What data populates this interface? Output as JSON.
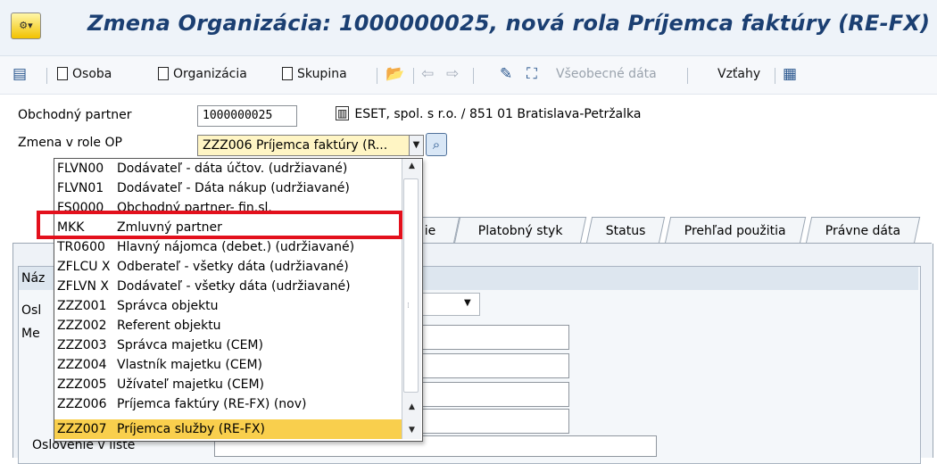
{
  "window": {
    "title": "Zmena Organizácia: 1000000025, nová rola Príjemca faktúry (RE-FX)"
  },
  "toolbar": {
    "person_label": "Osoba",
    "organization_label": "Organizácia",
    "group_label": "Skupina",
    "general_data_label": "Všeobecné dáta",
    "relations_label": "Vzťahy"
  },
  "header": {
    "partner_label": "Obchodný partner",
    "partner_value": "1000000025",
    "partner_description": "ESET, spol. s r.o. / 851 01 Bratislava-Petržalka",
    "role_label": "Zmena v role OP",
    "role_value": "ZZZ006 Príjemca faktúry (R..."
  },
  "tabs": [
    {
      "label": "ie"
    },
    {
      "label": "Platobný styk"
    },
    {
      "label": "Status"
    },
    {
      "label": "Prehľad použitia"
    },
    {
      "label": "Právne dáta"
    }
  ],
  "form": {
    "group_title_partial": "Náz",
    "field1_partial": "Osl",
    "field2_partial": "Me",
    "salutation_label": "Oslovenie v liste"
  },
  "dropdown": {
    "options": [
      {
        "code": "FLVN00",
        "desc": "Dodávateľ - dáta účtov. (udržiavané)"
      },
      {
        "code": "FLVN01",
        "desc": "Dodávateľ - Dáta nákup (udržiavané)"
      },
      {
        "code": "FS0000",
        "desc": "Obchodný partner- fin.sl."
      },
      {
        "code": "MKK",
        "desc": "Zmluvný partner"
      },
      {
        "code": "TR0600",
        "desc": "Hlavný nájomca (debet.) (udržiavané)"
      },
      {
        "code": "ZFLCU X",
        "desc": "Odberateľ - všetky dáta (udržiavané)"
      },
      {
        "code": "ZFLVN X",
        "desc": "Dodávateľ - všetky dáta (udržiavané)"
      },
      {
        "code": "ZZZ001",
        "desc": "Správca objektu"
      },
      {
        "code": "ZZZ002",
        "desc": "Referent objektu"
      },
      {
        "code": "ZZZ003",
        "desc": "Správca majetku (CEM)"
      },
      {
        "code": "ZZZ004",
        "desc": "Vlastník majetku (CEM)"
      },
      {
        "code": "ZZZ005",
        "desc": "Užívateľ majetku (CEM)"
      },
      {
        "code": "ZZZ006",
        "desc": "Príjemca faktúry (RE-FX) (nov)"
      },
      {
        "code": "ZZZ007",
        "desc": "Príjemca služby (RE-FX)"
      }
    ]
  }
}
